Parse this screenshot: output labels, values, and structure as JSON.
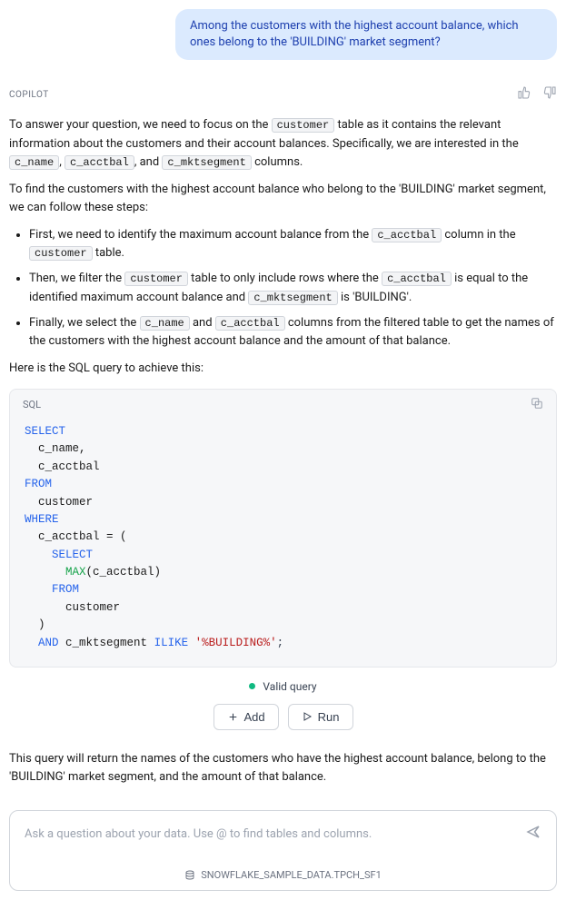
{
  "user_message": "Among the customers with the highest account balance, which ones belong to the 'BUILDING' market segment?",
  "copilot_label": "COPILOT",
  "p1_a": "To answer your question, we need to focus on the ",
  "p1_b": " table as it contains the relevant information about the customers and their account balances. Specifically, we are interested in the ",
  "p1_c": ", ",
  "p1_d": ", and ",
  "p1_e": " columns.",
  "p2": "To find the customers with the highest account balance who belong to the 'BUILDING' market segment, we can follow these steps:",
  "li1_a": "First, we need to identify the maximum account balance from the ",
  "li1_b": " column in the ",
  "li1_c": " table.",
  "li2_a": "Then, we filter the ",
  "li2_b": " table to only include rows where the ",
  "li2_c": " is equal to the identified maximum account balance and ",
  "li2_d": " is 'BUILDING'.",
  "li3_a": "Finally, we select the ",
  "li3_b": " and ",
  "li3_c": " columns from the filtered table to get the names of the customers with the highest account balance and the amount of that balance.",
  "p3": "Here is the SQL query to achieve this:",
  "code": {
    "customer": "customer",
    "c_name": "c_name",
    "c_acctbal": "c_acctbal",
    "c_mktsegment": "c_mktsegment"
  },
  "sql_label": "SQL",
  "sql": {
    "select": "SELECT",
    "l_cname": "  c_name,",
    "l_cacct": "  c_acctbal",
    "from": "FROM",
    "l_customer": "  customer",
    "where": "WHERE",
    "l_eq": "  c_acctbal = (",
    "l_sub_select": "SELECT",
    "l_max_fn": "MAX",
    "l_max_arg": "(c_acctbal)",
    "l_sub_from": "FROM",
    "l_sub_customer": "      customer",
    "l_close": "  )",
    "l_and": "AND",
    "l_ilike_col": " c_mktsegment ",
    "l_ilike": "ILIKE",
    "l_string": "'%BUILDING%'",
    "l_semi": ";"
  },
  "valid_query": "Valid query",
  "add_label": "Add",
  "run_label": "Run",
  "p4": "This query will return the names of the customers who have the highest account balance, belong to the 'BUILDING' market segment, and the amount of that balance.",
  "input_placeholder": "Ask a question about your data. Use @ to find tables and columns.",
  "data_source": "SNOWFLAKE_SAMPLE_DATA.TPCH_SF1"
}
